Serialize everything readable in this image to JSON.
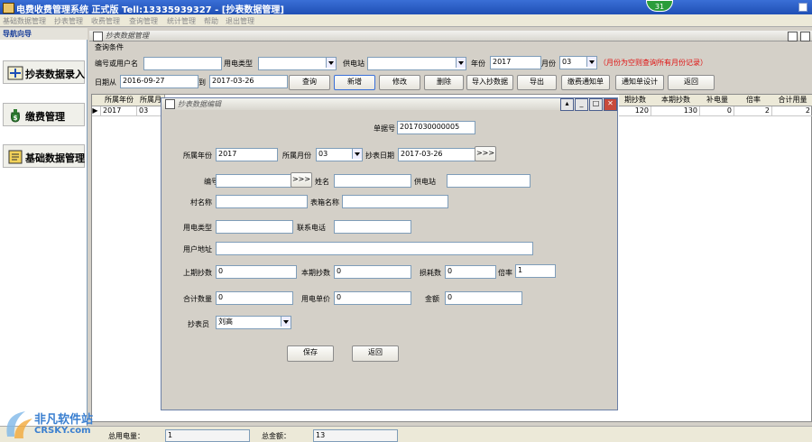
{
  "app": {
    "title": "电费收费管理系统  正式版  Tell:13335939327 - [抄表数据管理]",
    "badge": "31"
  },
  "menu": [
    "基础数据管理",
    "抄表管理",
    "收费管理",
    "查询管理",
    "统计管理",
    "帮助",
    "退出管理"
  ],
  "nav": {
    "header": "导航向导",
    "items": [
      "抄表数据录入",
      "缴费管理",
      "基础数据管理"
    ]
  },
  "main": {
    "window_title": "抄表数据管理",
    "query_group": "查询条件",
    "labels": {
      "user": "编号或用户名",
      "elec_type": "用电类型",
      "station": "供电站",
      "year": "年份",
      "month": "月份",
      "hint": "（月份为空则查询所有月份记录）",
      "date_from": "日期从",
      "date_to": "到"
    },
    "values": {
      "user": "",
      "elec_type": "",
      "station": "",
      "year": "2017",
      "month": "03",
      "date_from": "2016-09-27",
      "date_to": "2017-03-26"
    },
    "buttons": [
      "查询",
      "新增",
      "修改",
      "删除",
      "导入抄数据",
      "导出",
      "缴费通知单",
      "通知单设计",
      "返回"
    ]
  },
  "grid": {
    "headers": [
      "所属年份",
      "所属月",
      "期抄数",
      "本期抄数",
      "补电量",
      "倍率",
      "合计用量"
    ],
    "row": {
      "year": "2017",
      "month": "03",
      "prev": "120",
      "curr": "130",
      "extra": "0",
      "rate": "2",
      "total": "2"
    }
  },
  "dialog": {
    "title": "抄表数据编辑",
    "labels": {
      "doc_no": "单据号",
      "year": "所属年份",
      "month": "所属月份",
      "read_date": "抄表日期",
      "no": "编号",
      "name": "姓名",
      "station": "供电站",
      "village": "村名称",
      "box": "表箱名称",
      "elec_type": "用电类型",
      "phone": "联系电话",
      "address": "用户地址",
      "prev": "上期抄数",
      "curr": "本期抄数",
      "loss": "损耗数",
      "rate": "倍率",
      "total": "合计数量",
      "price": "用电单价",
      "amount": "金额",
      "reader": "抄表员"
    },
    "values": {
      "doc_no": "2017030000005",
      "year": "2017",
      "month": "03",
      "read_date": "2017-03-26",
      "no": "",
      "name": "",
      "station": "",
      "village": "",
      "box": "",
      "elec_type": "",
      "phone": "",
      "address": "",
      "prev": "0",
      "curr": "0",
      "loss": "0",
      "rate": "1",
      "total": "0",
      "price": "0",
      "amount": "0",
      "reader": "刘高"
    },
    "lookup": ">>>",
    "save": "保存",
    "back": "返回"
  },
  "status": {
    "total_power_label": "总用电量：",
    "total_power": "1",
    "total_amount_label": "总金额：",
    "total_amount": "13"
  },
  "watermark": {
    "cn": "非凡软件站",
    "en": "CRSKY.com"
  }
}
